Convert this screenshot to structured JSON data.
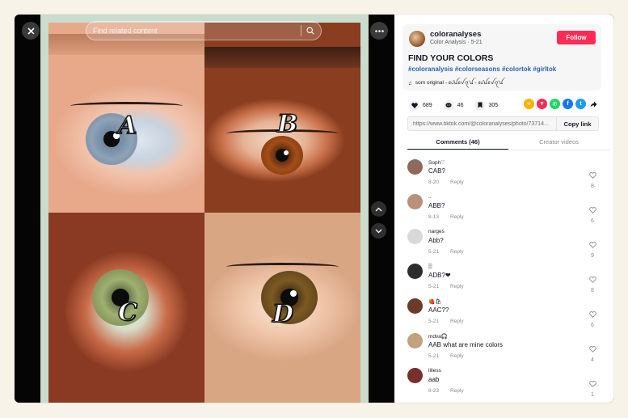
{
  "viewer": {
    "search_placeholder": "Find related content",
    "letters": [
      "A",
      "B",
      "C",
      "D"
    ]
  },
  "author": {
    "username": "coloranalyses",
    "subtitle": "Color Analysis · 5-21",
    "follow_label": "Follow"
  },
  "post": {
    "title": "FIND YOUR COLORS",
    "hashtags": "#coloranalysis #colorseasons #colortok #girltok",
    "music": "som original - ꫀᦔꪊꫀꪜꪖ'ꪊ - ꫀᦔꪊꫀꪜꪖ'ꪊ"
  },
  "actions": {
    "likes": "689",
    "comments": "46",
    "saves": "305"
  },
  "share_colors": [
    "#f5b400",
    "#fe2c55",
    "#25d366",
    "#1877f2",
    "#1d9bf0"
  ],
  "link": {
    "url": "https://www.tiktok.com/@coloranalyses/photo/73714...",
    "copy_label": "Copy link"
  },
  "tabs": {
    "comments": "Comments (46)",
    "creator": "Creator videos"
  },
  "comment_list": [
    {
      "user": "Soph♡",
      "text": "CAB?",
      "date": "8-20",
      "reply": "Reply",
      "likes": "8",
      "avatar": "#8f6a5a"
    },
    {
      "user": "..",
      "text": "ABB?",
      "date": "8-13",
      "reply": "Reply",
      "likes": "6",
      "avatar": "#b7917a"
    },
    {
      "user": "narges",
      "text": "Abb?",
      "date": "5-21",
      "reply": "Reply",
      "likes": "9",
      "avatar": "#d9d9d9"
    },
    {
      "user": "▒",
      "text": "ADB?❤",
      "date": "5-21",
      "reply": "Reply",
      "likes": "8",
      "avatar": "#2d2d2d"
    },
    {
      "user": "🍓🛍",
      "text": "AAC??",
      "date": "5-21",
      "reply": "Reply",
      "likes": "6",
      "avatar": "#6b3b2a"
    },
    {
      "user": "mdva🎧",
      "text": "AAB what are mine colors",
      "date": "5-21",
      "reply": "Reply",
      "likes": "4",
      "avatar": "#c2a27d"
    },
    {
      "user": "liliess",
      "text": "aab",
      "date": "8-23",
      "reply": "Reply",
      "likes": "1",
      "avatar": "#7a2f2a"
    }
  ]
}
